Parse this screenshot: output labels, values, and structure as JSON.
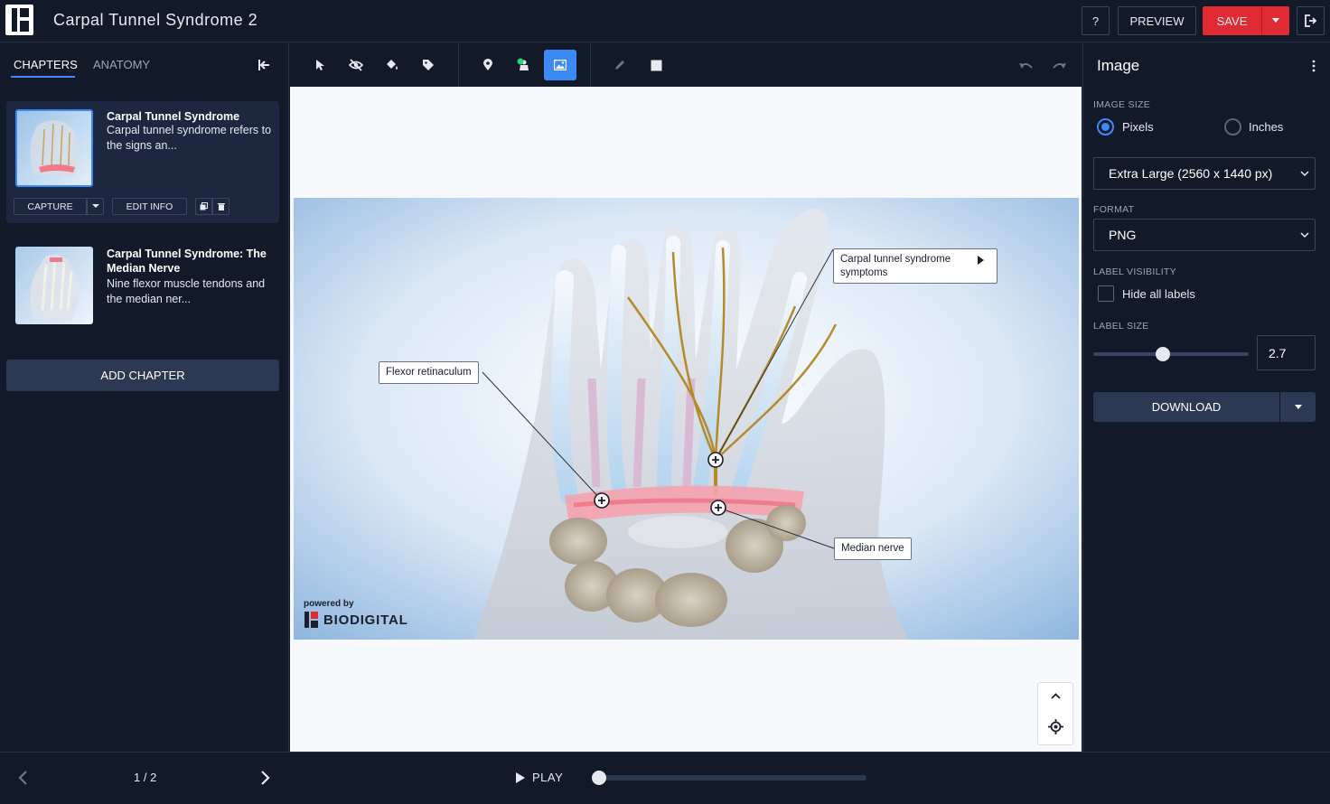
{
  "app": {
    "title": "Carpal Tunnel Syndrome 2",
    "help_label": "?",
    "preview_label": "PREVIEW",
    "save_label": "SAVE"
  },
  "left_panel": {
    "tabs": [
      {
        "label": "CHAPTERS",
        "active": true
      },
      {
        "label": "ANATOMY",
        "active": false
      }
    ],
    "chapters": [
      {
        "title": "Carpal Tunnel Syndrome",
        "description": "Carpal tunnel syndrome refers to the signs an...",
        "capture_label": "CAPTURE",
        "edit_label": "EDIT INFO"
      },
      {
        "title": "Carpal Tunnel Syndrome: The Median Nerve",
        "description": "Nine flexor muscle tendons and the median ner..."
      }
    ],
    "add_chapter_label": "ADD CHAPTER"
  },
  "canvas": {
    "labels": {
      "symptoms": "Carpal tunnel syndrome symptoms",
      "flexor": "Flexor retinaculum",
      "median": "Median nerve"
    },
    "watermark": {
      "powered_by": "powered by",
      "brand": "BIODIGITAL"
    }
  },
  "right_panel": {
    "title": "Image",
    "image_size_label": "IMAGE SIZE",
    "unit_options": [
      {
        "label": "Pixels",
        "selected": true
      },
      {
        "label": "Inches",
        "selected": false
      }
    ],
    "size_value": "Extra Large (2560 x 1440 px)",
    "format_label": "FORMAT",
    "format_value": "PNG",
    "label_visibility_label": "LABEL VISIBILITY",
    "hide_labels_text": "Hide all labels",
    "hide_labels_checked": false,
    "label_size_label": "LABEL SIZE",
    "label_size_value": "2.7",
    "label_size_fraction": 0.45,
    "download_label": "DOWNLOAD"
  },
  "bottom": {
    "page_indicator": "1 / 2",
    "play_label": "PLAY",
    "timeline_progress": 0
  },
  "colors": {
    "accent": "#3d8af7",
    "save": "#e02b35",
    "background": "#121a2a"
  }
}
